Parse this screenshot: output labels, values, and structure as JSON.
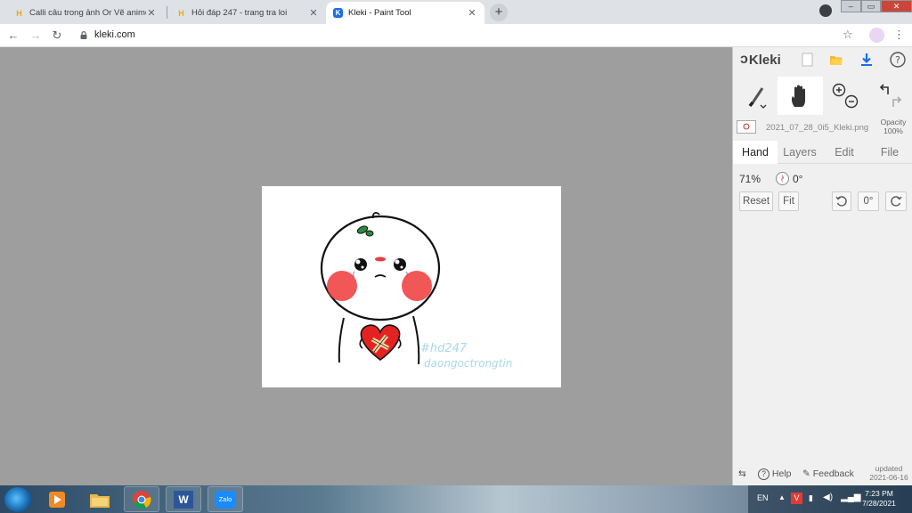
{
  "browser": {
    "tabs": [
      {
        "title": "Calli câu trong ảnh Or Vẽ anime",
        "favicon": "hoidap-icon",
        "active": false
      },
      {
        "title": "Hỏi đáp 247 - trang tra loi",
        "favicon": "hoidap-icon",
        "active": false
      },
      {
        "title": "Kleki - Paint Tool",
        "favicon": "kleki-icon",
        "active": true
      }
    ],
    "tab_close_glyph": "✕",
    "new_tab_glyph": "+",
    "url": "kleki.com",
    "window_controls": {
      "minimize": "–",
      "maximize": "▭",
      "close": "✕"
    }
  },
  "kleki": {
    "logo_text": "Kleki",
    "file_name": "2021_07_28_0i5_Kleki.png",
    "opacity_label": "Opacity",
    "opacity_value": "100%",
    "tabs": [
      "Hand",
      "Layers",
      "Edit",
      "File"
    ],
    "active_tab": "Hand",
    "zoom": "71%",
    "rotation": "0°",
    "buttons": {
      "reset": "Reset",
      "fit": "Fit",
      "rotate_value": "0°"
    },
    "footer": {
      "help": "Help",
      "feedback": "Feedback",
      "updated_label": "updated",
      "updated_date": "2021-06-16"
    },
    "accent_color": "#1a6ee8"
  },
  "canvas_art": {
    "watermark_line1": "#hd247",
    "watermark_line2": "daongoctrongtin"
  },
  "taskbar": {
    "apps": [
      "media-player-icon",
      "file-explorer-icon",
      "chrome-icon",
      "word-icon",
      "zalo-icon"
    ],
    "zalo_label": "Zalo",
    "word_label": "W",
    "language": "EN",
    "time": "7:23 PM",
    "date": "7/28/2021"
  }
}
